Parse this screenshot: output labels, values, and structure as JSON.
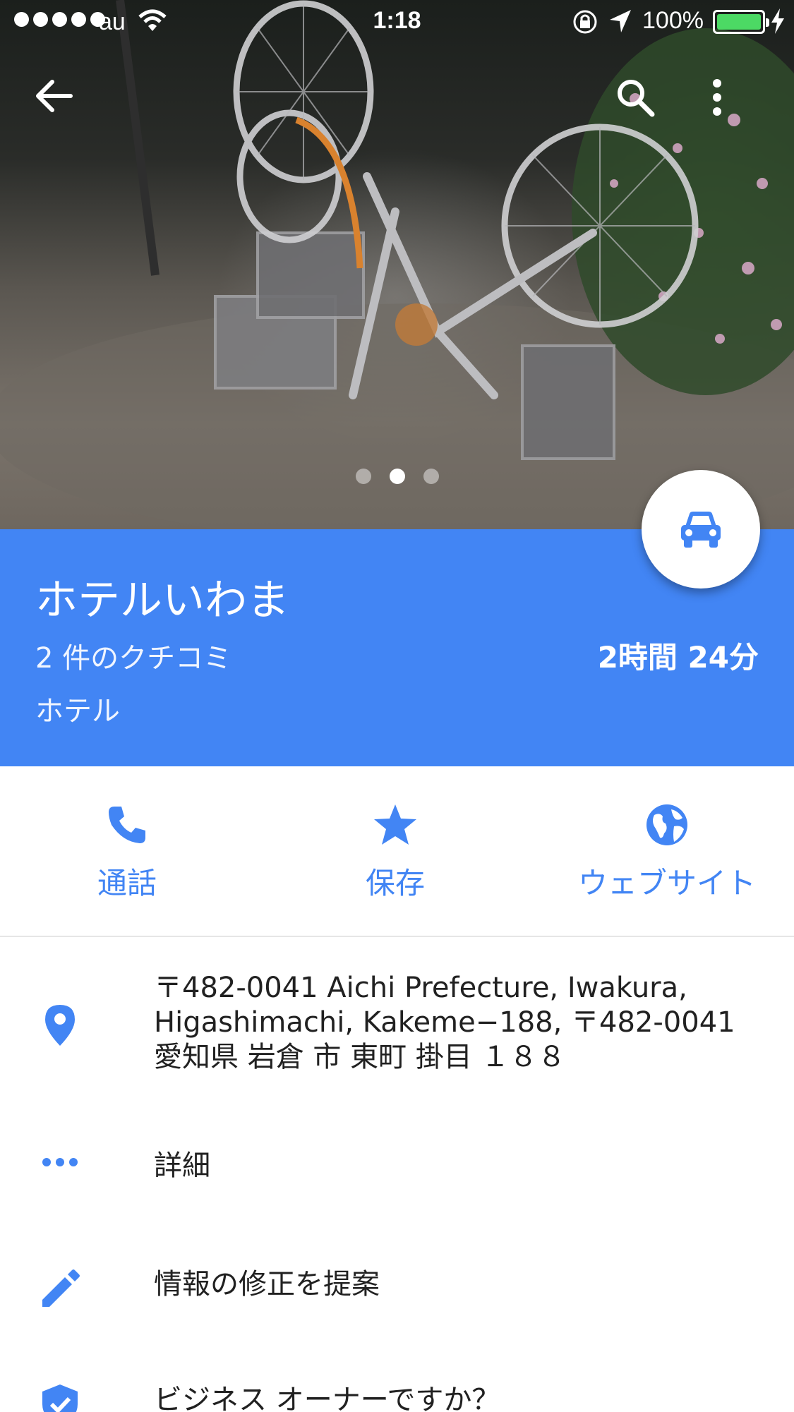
{
  "status_bar": {
    "carrier": "au",
    "time": "1:18",
    "battery": "100%"
  },
  "hero": {
    "photo_count": 3,
    "active_photo_index": 1
  },
  "place": {
    "title": "ホテルいわま",
    "reviews": "2 件のクチコミ",
    "category": "ホテル",
    "drive_time": "2時間 24分"
  },
  "actions": {
    "call": "通話",
    "save": "保存",
    "website": "ウェブサイト"
  },
  "details": {
    "address": "〒482-0041 Aichi Prefecture, Iwakura, Higashimachi, Kakeme−188, 〒482-0041 愛知県 岩倉 市 東町 掛目 １８８",
    "more": "詳細",
    "suggest_edit": "情報の修正を提案",
    "owner": "ビジネス オーナーですか？"
  },
  "colors": {
    "accent": "#4285f4",
    "battery": "#4cd964"
  },
  "icons": [
    "back-arrow-icon",
    "search-icon",
    "more-vert-icon",
    "car-icon",
    "phone-icon",
    "star-icon",
    "globe-icon",
    "location-pin-icon",
    "more-horiz-icon",
    "pencil-icon",
    "verified-shield-icon"
  ]
}
